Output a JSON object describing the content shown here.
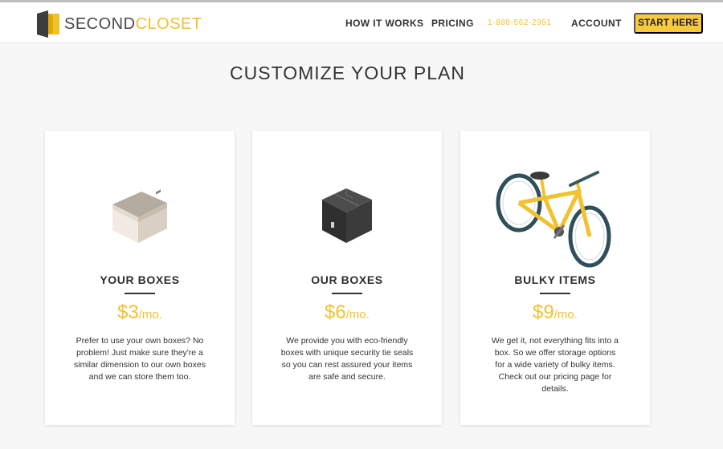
{
  "header": {
    "logo": {
      "part1": "SECOND",
      "part2": "CLOSET"
    },
    "nav": {
      "how_it_works": "HOW IT WORKS",
      "pricing": "PRICING",
      "phone": "1-888-562-2951",
      "account": "ACCOUNT"
    },
    "cta": "START HERE"
  },
  "page_title": "CUSTOMIZE YOUR PLAN",
  "plans": [
    {
      "title": "YOUR BOXES",
      "price": "$3",
      "unit": "/mo.",
      "description": "Prefer to use your own boxes? No problem! Just make sure they're a similar dimension to our own boxes and we can store them too.",
      "icon": "cardboard-box-icon"
    },
    {
      "title": "OUR BOXES",
      "price": "$6",
      "unit": "/mo.",
      "description": "We provide you with eco-friendly boxes with unique security tie seals so you can rest assured your items are safe and secure.",
      "icon": "black-box-icon"
    },
    {
      "title": "BULKY ITEMS",
      "price": "$9",
      "unit": "/mo.",
      "description": "We get it, not everything fits into a box. So we offer storage options for a wide variety of bulky items. Check out our pricing page for details.",
      "icon": "bicycle-icon"
    }
  ],
  "colors": {
    "accent": "#f2c12e",
    "button": "#f9c93c",
    "text": "#333333",
    "background": "#f7f7f7"
  }
}
